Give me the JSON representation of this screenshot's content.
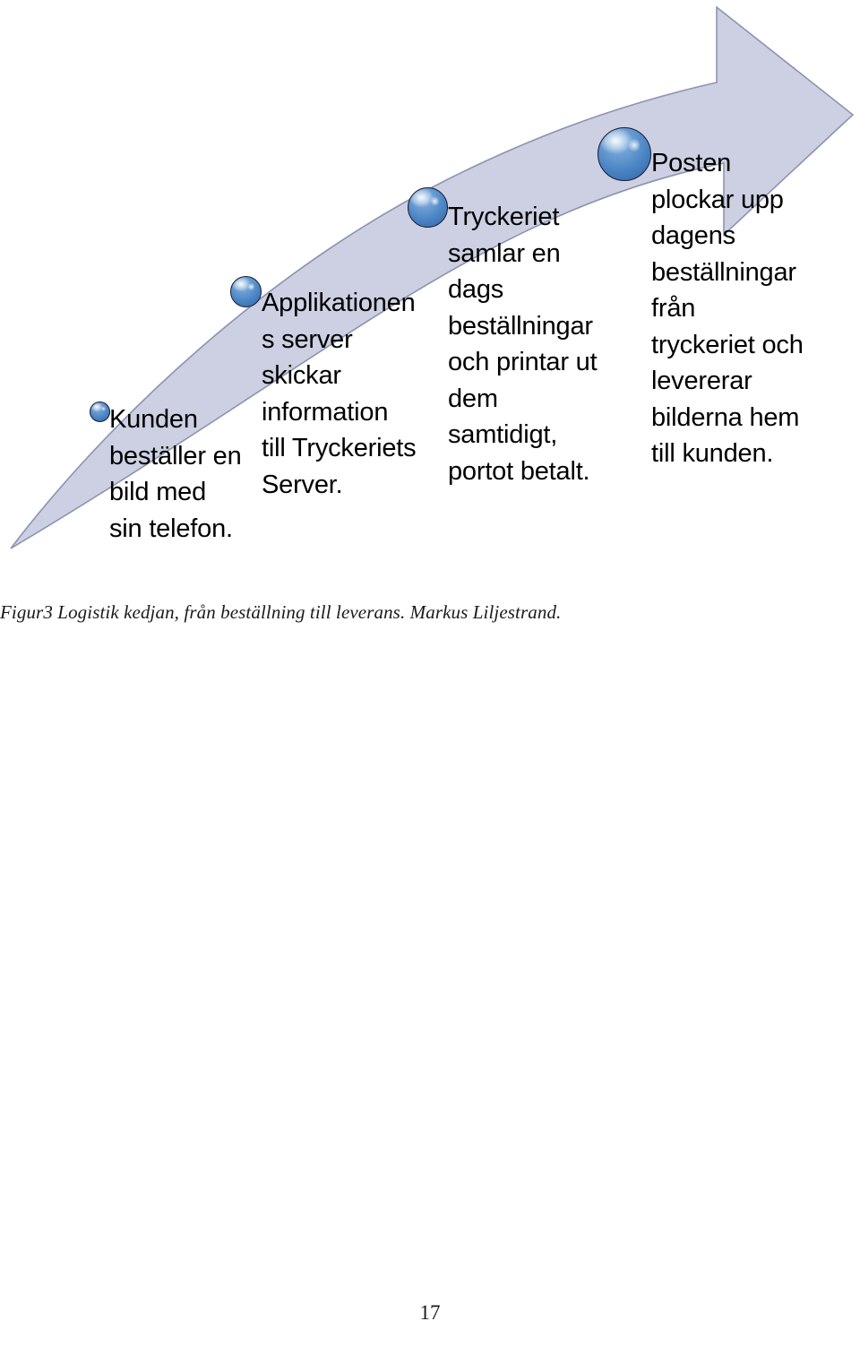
{
  "page": {
    "number": "17",
    "background_color": "#ffffff"
  },
  "figure": {
    "caption": "Figur3 Logistik kedjan, från beställning till leverans. Markus Liljestrand.",
    "arrow": {
      "fill_color": "#ccd0e2",
      "stroke_color": "#8d93b0",
      "direction": "curved-up-right"
    },
    "bullet_color": "#4a84c4",
    "stages": [
      {
        "index": "1",
        "bullet_name": "stage-bullet-kunden",
        "text": "Kunden beställer en bild med sin telefon."
      },
      {
        "index": "2",
        "bullet_name": "stage-bullet-applikationens-server",
        "text": "Applikationens server skickar information till Tryckeriets Server."
      },
      {
        "index": "3",
        "bullet_name": "stage-bullet-tryckeriet",
        "text": "Tryckeriet samlar en dags beställningar och printar ut dem samtidigt, portot betalt."
      },
      {
        "index": "4",
        "bullet_name": "stage-bullet-posten",
        "text": "Posten plockar upp dagens beställningar från tryckeriet och levererar bilderna hem till kunden."
      }
    ]
  }
}
